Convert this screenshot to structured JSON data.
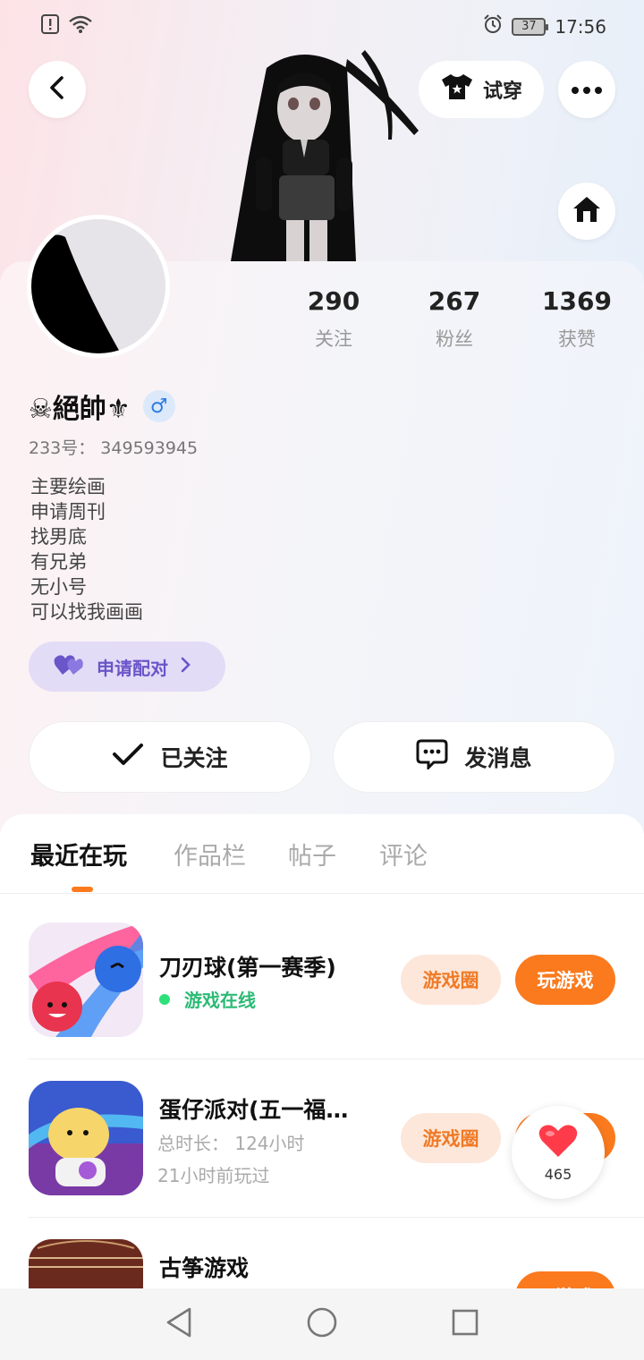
{
  "status_bar": {
    "time": "17:56",
    "battery": "37",
    "icons": [
      "alert-icon",
      "wifi-icon",
      "alarm-icon",
      "battery-icon"
    ]
  },
  "header": {
    "tryon_label": "试穿"
  },
  "profile": {
    "name": "☠絕帥⚜",
    "gender": "♂",
    "uid": "233号： 349593945",
    "bio": [
      "主要绘画",
      "申请周刊",
      "找男底",
      "有兄弟",
      "无小号",
      "可以找我画画"
    ],
    "pair_label": "申请配对",
    "stats": [
      {
        "num": "290",
        "label": "关注"
      },
      {
        "num": "267",
        "label": "粉丝"
      },
      {
        "num": "1369",
        "label": "获赞"
      }
    ],
    "follow_label": "已关注",
    "message_label": "发消息"
  },
  "tabs": [
    "最近在玩",
    "作品栏",
    "帖子",
    "评论"
  ],
  "games": [
    {
      "title": "刀刃球(第一赛季)",
      "status": "游戏在线",
      "circle_label": "游戏圈",
      "play_label": "玩游戏"
    },
    {
      "title": "蛋仔派对(五一福…",
      "duration": "总时长： 124小时",
      "last_played": "21小时前玩过",
      "circle_label": "游戏圈",
      "play_label": "玩游戏"
    },
    {
      "title": "古筝游戏",
      "play_label": "玩游戏"
    }
  ],
  "like_count": "465",
  "colors": {
    "accent": "#fb7a1e",
    "pair_purple": "#6a55c9",
    "online_green": "#2cba75"
  }
}
